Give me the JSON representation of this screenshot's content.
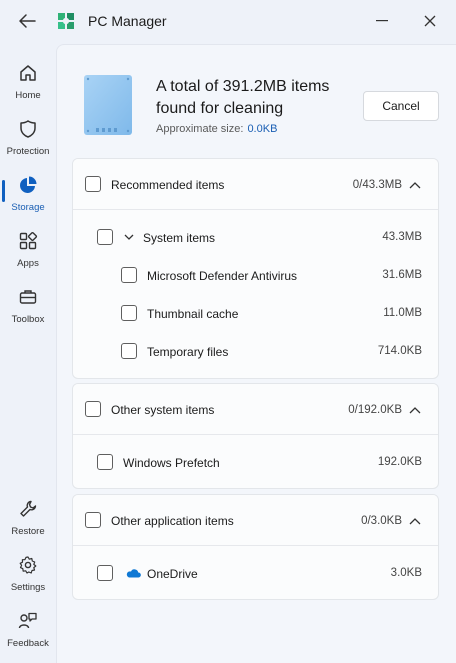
{
  "window": {
    "title": "PC Manager"
  },
  "sidebar": {
    "items": [
      {
        "label": "Home",
        "icon": "home-icon"
      },
      {
        "label": "Protection",
        "icon": "shield-icon"
      },
      {
        "label": "Storage",
        "icon": "pie-chart-icon",
        "active": true
      },
      {
        "label": "Apps",
        "icon": "apps-icon"
      },
      {
        "label": "Toolbox",
        "icon": "toolbox-icon"
      }
    ],
    "bottom_items": [
      {
        "label": "Restore",
        "icon": "wrench-icon"
      },
      {
        "label": "Settings",
        "icon": "gear-icon"
      },
      {
        "label": "Feedback",
        "icon": "feedback-icon"
      }
    ]
  },
  "summary": {
    "headline": "A total of 391.2MB items found for cleaning",
    "approx_label": "Approximate size:",
    "approx_value": "0.0KB",
    "cancel_label": "Cancel"
  },
  "groups": [
    {
      "title": "Recommended items",
      "size": "0/43.3MB",
      "subgroup": {
        "title": "System items",
        "size": "43.3MB"
      },
      "items": [
        {
          "label": "Microsoft Defender Antivirus",
          "size": "31.6MB"
        },
        {
          "label": "Thumbnail cache",
          "size": "11.0MB"
        },
        {
          "label": "Temporary files",
          "size": "714.0KB"
        }
      ]
    },
    {
      "title": "Other system items",
      "size": "0/192.0KB",
      "items": [
        {
          "label": "Windows Prefetch",
          "size": "192.0KB"
        }
      ]
    },
    {
      "title": "Other application items",
      "size": "0/3.0KB",
      "items": [
        {
          "label": "OneDrive",
          "size": "3.0KB",
          "icon": "onedrive-cloud-icon"
        }
      ]
    }
  ],
  "colors": {
    "accent": "#1060c0",
    "onedrive": "#0f78d4"
  }
}
